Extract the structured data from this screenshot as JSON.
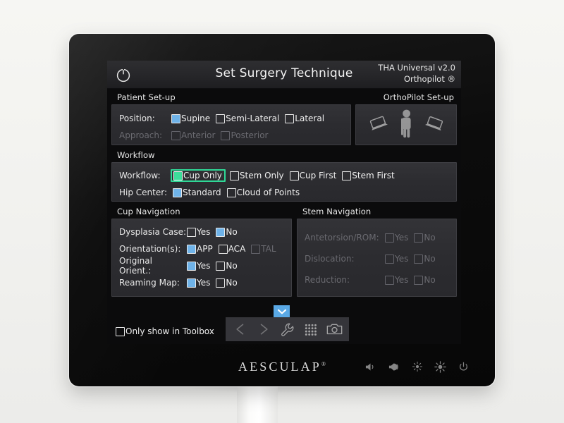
{
  "device": {
    "brand": "AESCULAP",
    "brand_mark": "®",
    "bezel_buttons": [
      {
        "name": "volume-down-icon",
        "label": "Volume down"
      },
      {
        "name": "volume-up-icon",
        "label": "Volume up"
      },
      {
        "name": "brightness-down-icon",
        "label": "Brightness down"
      },
      {
        "name": "brightness-up-icon",
        "label": "Brightness up"
      },
      {
        "name": "power-icon",
        "label": "Power"
      }
    ]
  },
  "titlebar": {
    "power_icon": "power-icon",
    "title": "Set Surgery Technique",
    "product": "THA Universal v2.0",
    "system": "Orthopilot ®"
  },
  "colors": {
    "checkbox_checked": "#6fb3e9",
    "highlight_green": "#2fd796",
    "checkbox_green_fill": "#3ddc9a",
    "panel_bg": "#2e2e32",
    "screen_bg": "#0b0b0c",
    "tab_blue": "#5aa9e6"
  },
  "patient_setup": {
    "label": "Patient Set-up",
    "rows": [
      {
        "label": "Position:",
        "disabled": false,
        "options": [
          {
            "label": "Supine",
            "checked": true
          },
          {
            "label": "Semi-Lateral",
            "checked": false
          },
          {
            "label": "Lateral",
            "checked": false
          }
        ]
      },
      {
        "label": "Approach:",
        "disabled": true,
        "options": [
          {
            "label": "Anterior",
            "checked": false
          },
          {
            "label": "Posterior",
            "checked": false
          }
        ]
      }
    ]
  },
  "ortho_setup": {
    "label": "OrthoPilot Set-up",
    "icons": [
      "camera-tilt-left-icon",
      "patient-figure-icon",
      "camera-tilt-right-icon"
    ]
  },
  "workflow": {
    "label": "Workflow",
    "rows": [
      {
        "label": "Workflow:",
        "disabled": false,
        "options": [
          {
            "label": "Cup Only",
            "checked": true,
            "highlighted": true,
            "style": "green"
          },
          {
            "label": "Stem Only",
            "checked": false
          },
          {
            "label": "Cup First",
            "checked": false
          },
          {
            "label": "Stem First",
            "checked": false
          }
        ]
      },
      {
        "label": "Hip Center:",
        "disabled": false,
        "options": [
          {
            "label": "Standard",
            "checked": true
          },
          {
            "label": "Cloud of Points",
            "checked": false
          }
        ]
      }
    ]
  },
  "cup_navigation": {
    "label": "Cup Navigation",
    "rows": [
      {
        "label": "Dysplasia Case:",
        "disabled": false,
        "options": [
          {
            "label": "Yes",
            "checked": false
          },
          {
            "label": "No",
            "checked": true
          }
        ]
      },
      {
        "label": "Orientation(s):",
        "disabled": false,
        "options": [
          {
            "label": "APP",
            "checked": true
          },
          {
            "label": "ACA",
            "checked": false
          },
          {
            "label": "TAL",
            "checked": false,
            "disabled": true
          }
        ]
      },
      {
        "label": "Original Orient.:",
        "disabled": false,
        "options": [
          {
            "label": "Yes",
            "checked": true
          },
          {
            "label": "No",
            "checked": false
          }
        ]
      },
      {
        "label": "Reaming Map:",
        "disabled": false,
        "options": [
          {
            "label": "Yes",
            "checked": true
          },
          {
            "label": "No",
            "checked": false
          }
        ]
      }
    ]
  },
  "stem_navigation": {
    "label": "Stem Navigation",
    "disabled": true,
    "rows": [
      {
        "label": "Antetorsion/ROM:",
        "disabled": true,
        "options": [
          {
            "label": "Yes",
            "checked": false
          },
          {
            "label": "No",
            "checked": false
          }
        ]
      },
      {
        "label": "Dislocation:",
        "disabled": true,
        "options": [
          {
            "label": "Yes",
            "checked": false
          },
          {
            "label": "No",
            "checked": false
          }
        ]
      },
      {
        "label": "Reduction:",
        "disabled": true,
        "options": [
          {
            "label": "Yes",
            "checked": false
          },
          {
            "label": "No",
            "checked": false
          }
        ]
      }
    ]
  },
  "bottom": {
    "toolbox_checkbox": {
      "label": "Only show in Toolbox",
      "checked": false
    },
    "toolbar_tab_icon": "chevron-down-icon",
    "toolbar_buttons": [
      {
        "name": "back-icon",
        "label": "<",
        "faded": true
      },
      {
        "name": "forward-icon",
        "label": ">",
        "faded": true
      },
      {
        "name": "wrench-icon",
        "label": "Settings",
        "faded": false
      },
      {
        "name": "keypad-grid-icon",
        "label": "Keypad",
        "faded": false
      },
      {
        "name": "camera-icon",
        "label": "Screenshot",
        "faded": false
      }
    ]
  }
}
